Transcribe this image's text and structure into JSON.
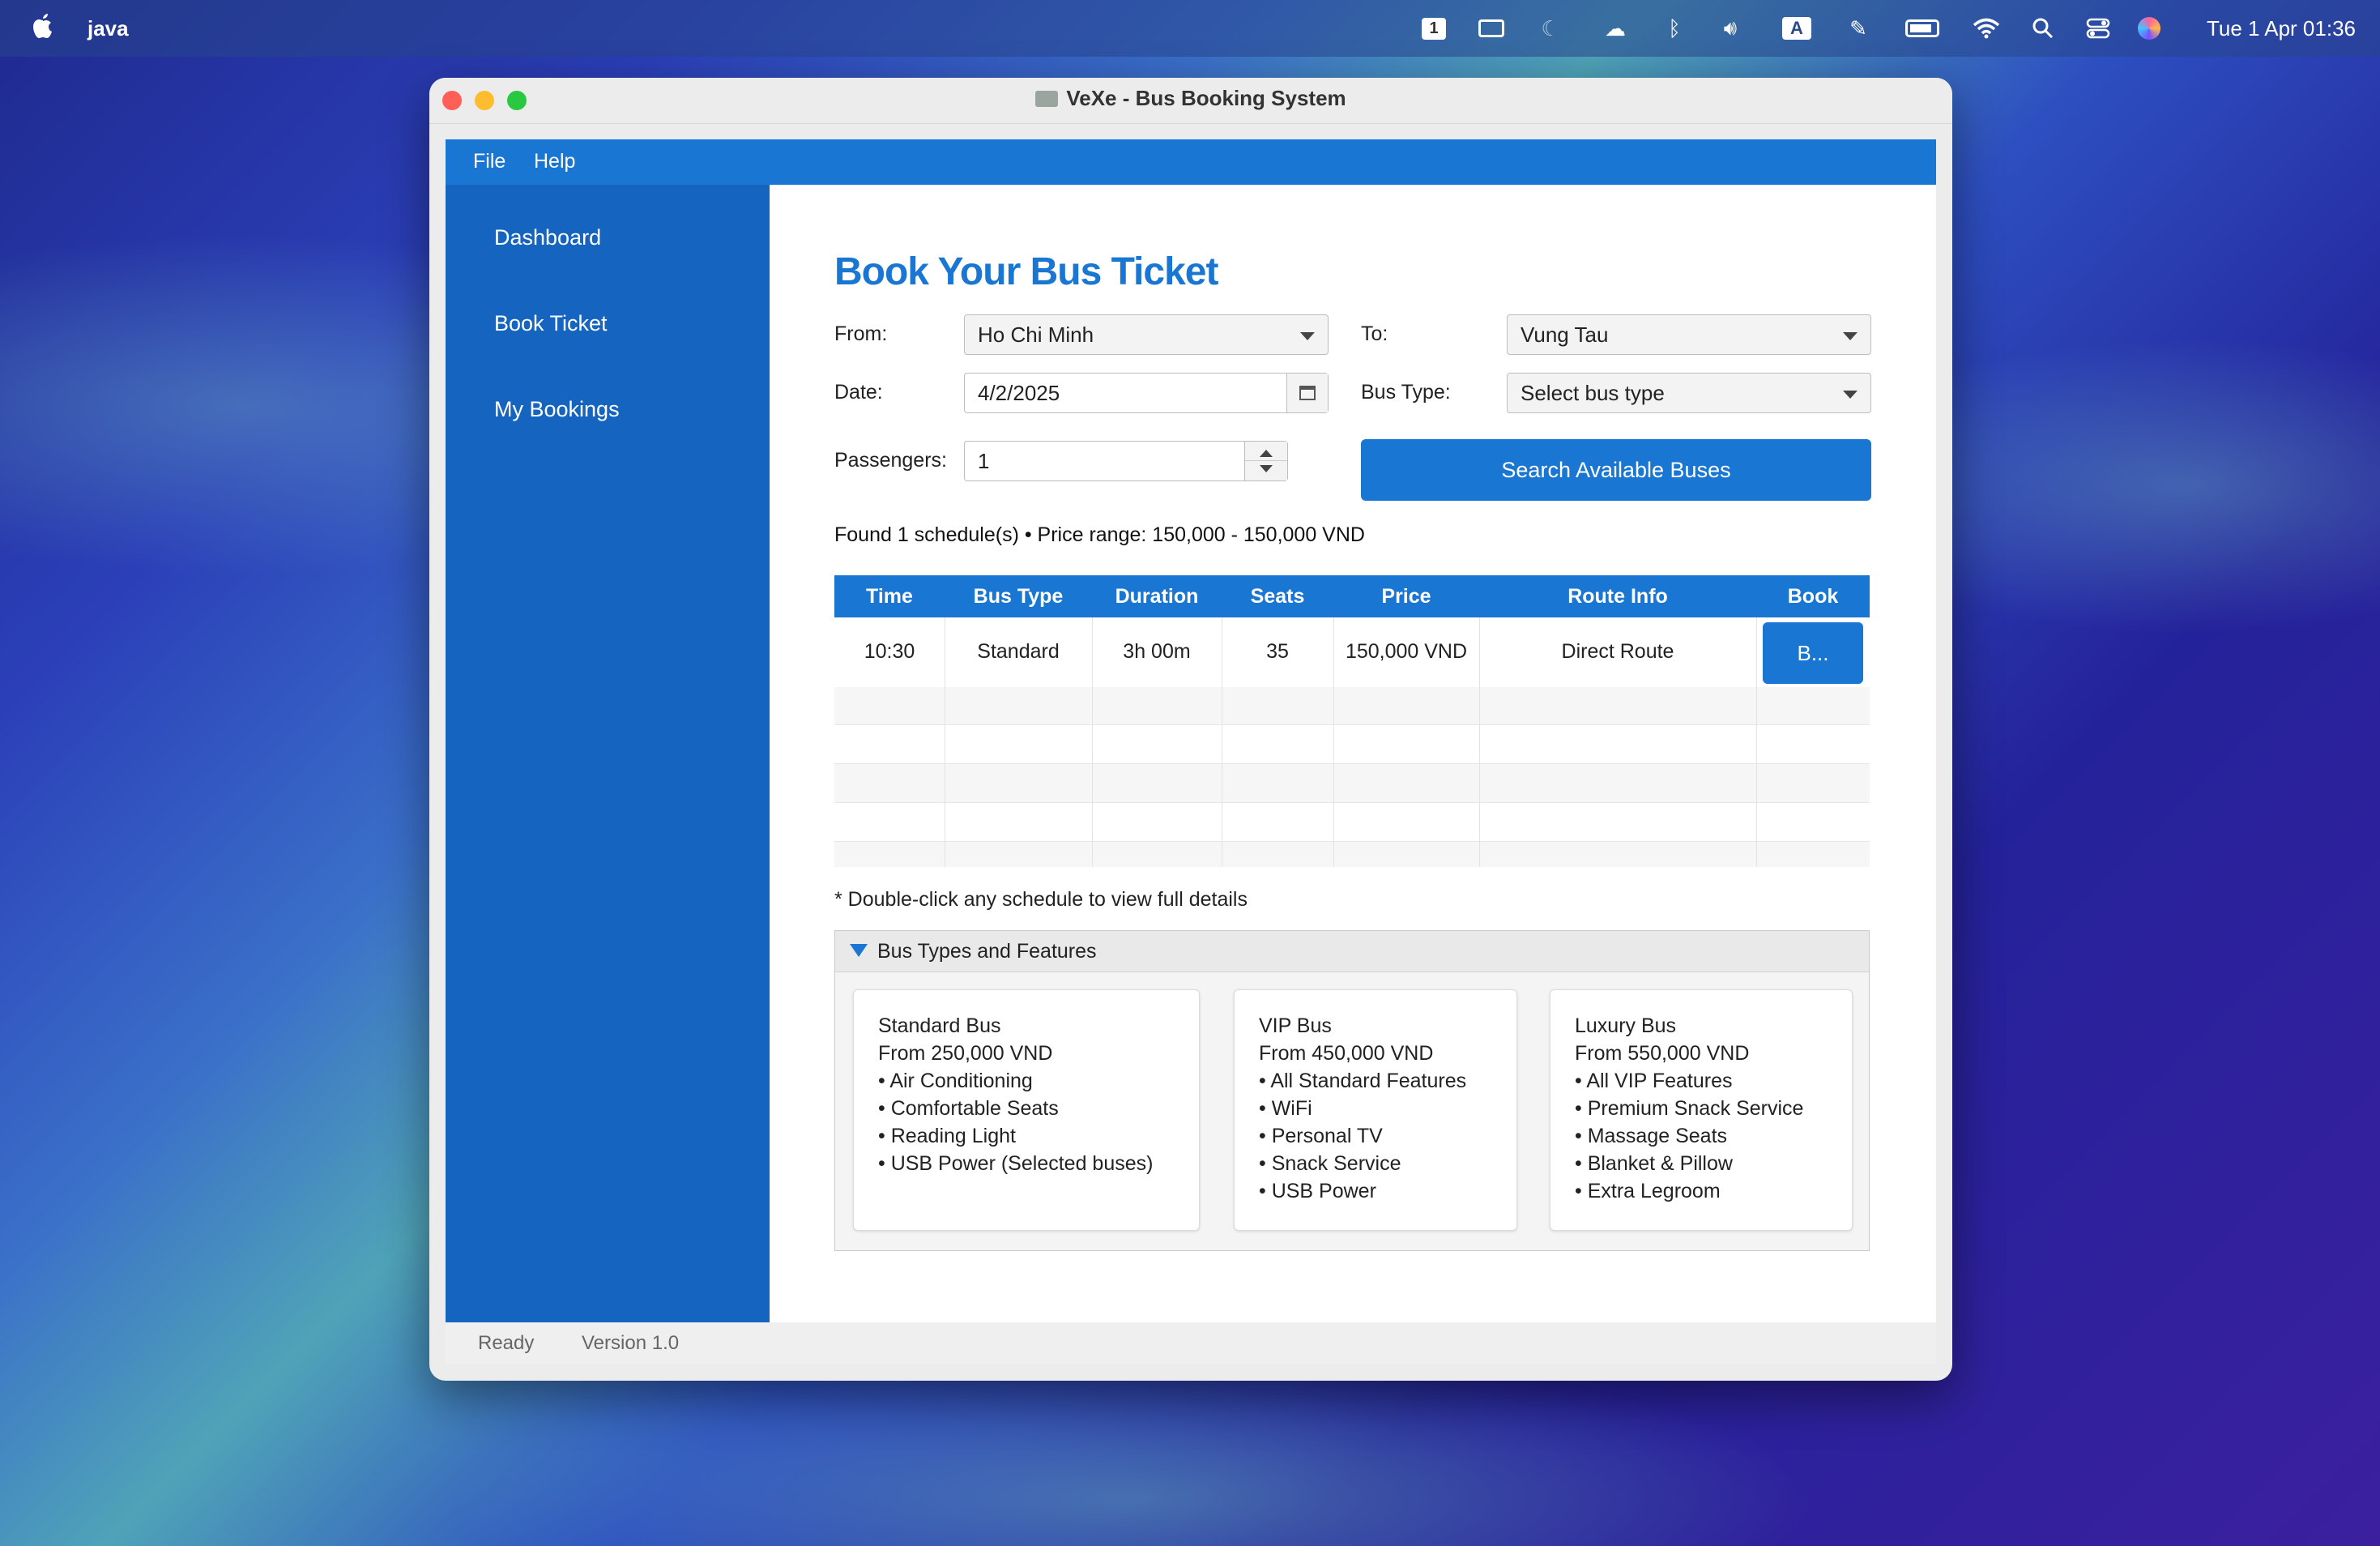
{
  "menubar": {
    "app_name": "java",
    "clock": "Tue 1 Apr  01:36",
    "icons": [
      "apple-icon",
      "desktop-1-icon",
      "keyboard-icon",
      "moon-icon",
      "cloud-icon",
      "bluetooth-icon",
      "volume-icon",
      "input-a-icon",
      "pen-icon",
      "battery-icon",
      "wifi-icon",
      "search-icon",
      "control-center-icon",
      "siri-icon"
    ],
    "desktop_num": "1",
    "input_letter": "A"
  },
  "window": {
    "title": "VeXe - Bus Booking System"
  },
  "app_menu": {
    "file": "File",
    "help": "Help"
  },
  "sidebar": {
    "items": [
      {
        "label": "Dashboard"
      },
      {
        "label": "Book Ticket"
      },
      {
        "label": "My Bookings"
      }
    ]
  },
  "form": {
    "page_title": "Book Your Bus Ticket",
    "from_label": "From:",
    "from_value": "Ho Chi Minh",
    "to_label": "To:",
    "to_value": "Vung Tau",
    "date_label": "Date:",
    "date_value": "4/2/2025",
    "bus_type_label": "Bus Type:",
    "bus_type_value": "Select bus type",
    "passengers_label": "Passengers:",
    "passengers_value": "1",
    "search_button": "Search Available Buses"
  },
  "results": {
    "summary": "Found 1 schedule(s) • Price range: 150,000 - 150,000 VND",
    "columns": [
      "Time",
      "Bus Type",
      "Duration",
      "Seats",
      "Price",
      "Route Info",
      "Book"
    ],
    "rows": [
      {
        "time": "10:30",
        "bus_type": "Standard",
        "duration": "3h 00m",
        "seats": "35",
        "price": "150,000 VND",
        "route": "Direct Route",
        "book": "B..."
      }
    ],
    "note": "* Double-click any schedule to view full details"
  },
  "features": {
    "title": "Bus Types and Features",
    "cards": [
      {
        "lines": [
          "Standard Bus",
          "From 250,000 VND",
          "• Air Conditioning",
          "• Comfortable Seats",
          "• Reading Light",
          "• USB Power (Selected buses)"
        ]
      },
      {
        "lines": [
          "VIP Bus",
          "From 450,000 VND",
          "• All Standard Features",
          "• WiFi",
          "• Personal TV",
          "• Snack Service",
          "• USB Power"
        ]
      },
      {
        "lines": [
          "Luxury Bus",
          "From 550,000 VND",
          "• All VIP Features",
          "• Premium Snack Service",
          "• Massage Seats",
          "• Blanket & Pillow",
          "• Extra Legroom"
        ]
      }
    ]
  },
  "status": {
    "state": "Ready",
    "version": "Version 1.0"
  },
  "colors": {
    "accent": "#1976d2",
    "sidebar": "#1565c0",
    "title_blue": "#1976d2"
  }
}
